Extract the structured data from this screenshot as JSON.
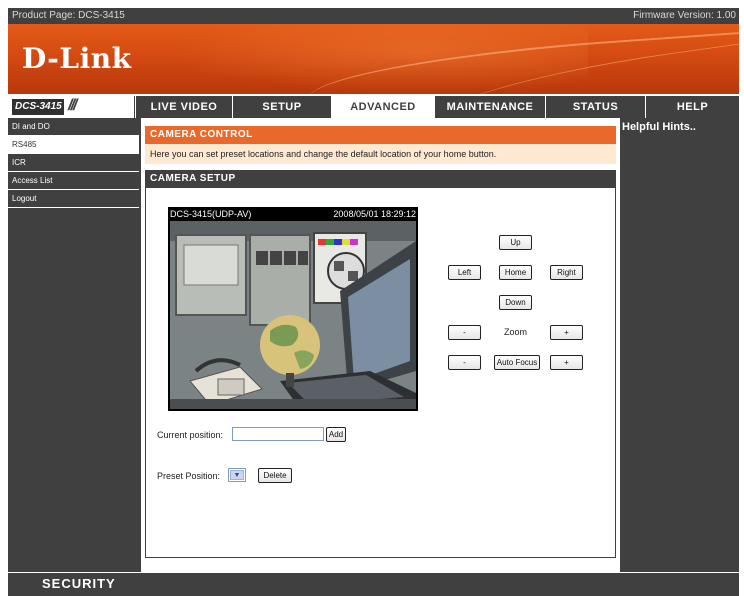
{
  "top_bar": {
    "product_page": "Product Page: DCS-3415",
    "firmware": "Firmware Version: 1.00"
  },
  "brand": {
    "logo_text": "D-Link",
    "model_label": "DCS-3415",
    "model_slashes": "///"
  },
  "nav": {
    "tabs": [
      {
        "label": "LIVE VIDEO"
      },
      {
        "label": "SETUP"
      },
      {
        "label": "ADVANCED"
      },
      {
        "label": "MAINTENANCE"
      },
      {
        "label": "STATUS"
      },
      {
        "label": "HELP"
      }
    ],
    "active_tab": "ADVANCED"
  },
  "sidebar": {
    "items": [
      {
        "label": "DI and DO"
      },
      {
        "label": "RS485"
      },
      {
        "label": "ICR"
      },
      {
        "label": "Access List"
      },
      {
        "label": "Logout"
      }
    ],
    "active_item": "RS485"
  },
  "main": {
    "camera_control_title": "CAMERA CONTROL",
    "camera_control_desc": "Here you can set preset locations and change the default location of your home button.",
    "camera_setup_title": "CAMERA SETUP",
    "video": {
      "name": "DCS-3415(UDP-AV)",
      "timestamp": "2008/05/01 18:29:12"
    },
    "ptz": {
      "up": "Up",
      "left": "Left",
      "home": "Home",
      "right": "Right",
      "down": "Down",
      "zoom_minus": "-",
      "zoom_label": "Zoom",
      "zoom_plus": "+",
      "focus_minus": "-",
      "focus_label": "Auto Focus",
      "focus_plus": "+"
    },
    "current_position": {
      "label": "Current position:",
      "value": "",
      "add_label": "Add"
    },
    "preset_position": {
      "label": "Preset Position:",
      "selected": "",
      "delete_label": "Delete"
    }
  },
  "hints": {
    "title": "Helpful Hints.."
  },
  "footer": {
    "security_label": "SECURITY"
  },
  "colors": {
    "orange_header": "#e8692b",
    "dark_bg": "#404040",
    "desc_bg": "#ffe9d2"
  }
}
